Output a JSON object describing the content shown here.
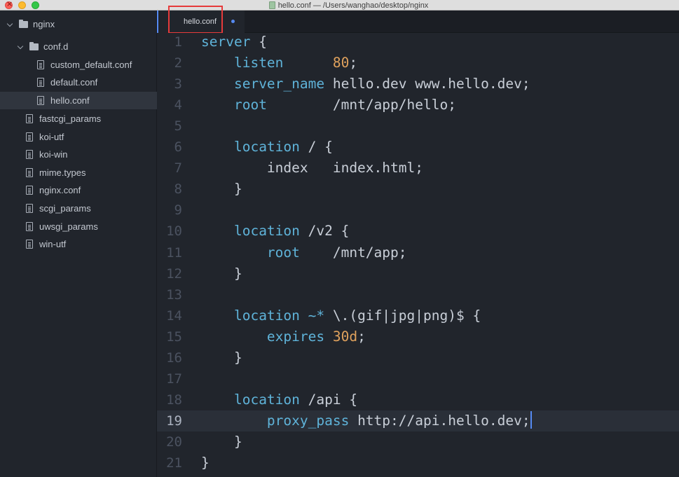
{
  "window": {
    "title": "hello.conf — /Users/wanghao/desktop/nginx"
  },
  "sidebar": {
    "root": "nginx",
    "folder": "conf.d",
    "folder_files": [
      "custom_default.conf",
      "default.conf",
      "hello.conf"
    ],
    "selected": "hello.conf",
    "files": [
      "fastcgi_params",
      "koi-utf",
      "koi-win",
      "mime.types",
      "nginx.conf",
      "scgi_params",
      "uwsgi_params",
      "win-utf"
    ]
  },
  "tab": {
    "label": "hello.conf",
    "modified": true
  },
  "editor": {
    "current_line": 19,
    "lines": [
      {
        "n": "1",
        "tokens": [
          [
            "kw",
            "server"
          ],
          [
            "",
            " {"
          ]
        ]
      },
      {
        "n": "2",
        "tokens": [
          [
            "",
            "    "
          ],
          [
            "kw",
            "listen"
          ],
          [
            "",
            "      "
          ],
          [
            "num",
            "80"
          ],
          [
            "",
            ";"
          ]
        ]
      },
      {
        "n": "3",
        "tokens": [
          [
            "",
            "    "
          ],
          [
            "kw",
            "server_name"
          ],
          [
            "",
            " hello.dev www.hello.dev;"
          ]
        ]
      },
      {
        "n": "4",
        "tokens": [
          [
            "",
            "    "
          ],
          [
            "kw",
            "root"
          ],
          [
            "",
            "        /mnt/app/hello;"
          ]
        ]
      },
      {
        "n": "5",
        "tokens": []
      },
      {
        "n": "6",
        "tokens": [
          [
            "",
            "    "
          ],
          [
            "kw",
            "location"
          ],
          [
            "",
            " / {"
          ]
        ]
      },
      {
        "n": "7",
        "tokens": [
          [
            "",
            "        index   index.html;"
          ]
        ]
      },
      {
        "n": "8",
        "tokens": [
          [
            "",
            "    }"
          ]
        ]
      },
      {
        "n": "9",
        "tokens": []
      },
      {
        "n": "10",
        "tokens": [
          [
            "",
            "    "
          ],
          [
            "kw",
            "location"
          ],
          [
            "",
            " /v2 {"
          ]
        ]
      },
      {
        "n": "11",
        "tokens": [
          [
            "",
            "        "
          ],
          [
            "kw",
            "root"
          ],
          [
            "",
            "    /mnt/app;"
          ]
        ]
      },
      {
        "n": "12",
        "tokens": [
          [
            "",
            "    }"
          ]
        ]
      },
      {
        "n": "13",
        "tokens": []
      },
      {
        "n": "14",
        "tokens": [
          [
            "",
            "    "
          ],
          [
            "kw",
            "location"
          ],
          [
            "",
            " "
          ],
          [
            "kw",
            "~*"
          ],
          [
            "",
            " \\.(gif|jpg|png)$ {"
          ]
        ]
      },
      {
        "n": "15",
        "tokens": [
          [
            "",
            "        "
          ],
          [
            "kw",
            "expires"
          ],
          [
            "",
            " "
          ],
          [
            "num",
            "30d"
          ],
          [
            "",
            ";"
          ]
        ]
      },
      {
        "n": "16",
        "tokens": [
          [
            "",
            "    }"
          ]
        ]
      },
      {
        "n": "17",
        "tokens": []
      },
      {
        "n": "18",
        "tokens": [
          [
            "",
            "    "
          ],
          [
            "kw",
            "location"
          ],
          [
            "",
            " /api {"
          ]
        ]
      },
      {
        "n": "19",
        "tokens": [
          [
            "",
            "        "
          ],
          [
            "kw",
            "proxy_pass"
          ],
          [
            "",
            " http://api.hello.dev;"
          ]
        ]
      },
      {
        "n": "20",
        "tokens": [
          [
            "",
            "    }"
          ]
        ]
      },
      {
        "n": "21",
        "tokens": [
          [
            "",
            "}"
          ]
        ]
      }
    ]
  },
  "colors": {
    "keyword": "#5fb3d9",
    "number": "#e0a25d",
    "accent": "#568af2",
    "highlight_box": "#e63b3b"
  }
}
